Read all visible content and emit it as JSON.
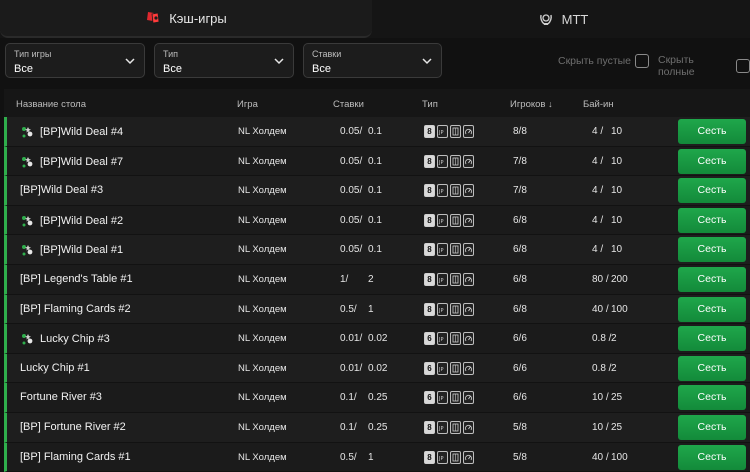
{
  "tabs": [
    {
      "label": "Кэш-игры",
      "icon": "poker-cards-icon",
      "active": true
    },
    {
      "label": "MTT",
      "icon": "trophy-wreath-icon",
      "active": false
    }
  ],
  "filters": {
    "game_type": {
      "label": "Тип игры",
      "value": "Все"
    },
    "type": {
      "label": "Тип",
      "value": "Все"
    },
    "stakes": {
      "label": "Ставки",
      "value": "Все"
    },
    "hide_empty": "Скрыть пустые",
    "hide_full": "Скрыть полные"
  },
  "table": {
    "headers": {
      "name": "Название стола",
      "game": "Игра",
      "stakes": "Ставки",
      "type": "Тип",
      "players": "Игроков",
      "buyin": "Бай-ин"
    },
    "sit_label": "Сесть",
    "rows": [
      {
        "name": "[BP]Wild Deal #4",
        "bp": true,
        "game": "NL Холдем",
        "stake_a": "0.05/",
        "stake_b": "0.1",
        "seats": "8",
        "players": "8/8",
        "buyin_a": "4 /",
        "buyin_b": "10"
      },
      {
        "name": "[BP]Wild Deal #7",
        "bp": true,
        "game": "NL Холдем",
        "stake_a": "0.05/",
        "stake_b": "0.1",
        "seats": "8",
        "players": "7/8",
        "buyin_a": "4 /",
        "buyin_b": "10"
      },
      {
        "name": "[BP]Wild Deal #3",
        "bp": false,
        "game": "NL Холдем",
        "stake_a": "0.05/",
        "stake_b": "0.1",
        "seats": "8",
        "players": "7/8",
        "buyin_a": "4 /",
        "buyin_b": "10"
      },
      {
        "name": "[BP]Wild Deal #2",
        "bp": true,
        "game": "NL Холдем",
        "stake_a": "0.05/",
        "stake_b": "0.1",
        "seats": "8",
        "players": "6/8",
        "buyin_a": "4 /",
        "buyin_b": "10"
      },
      {
        "name": "[BP]Wild Deal #1",
        "bp": true,
        "game": "NL Холдем",
        "stake_a": "0.05/",
        "stake_b": "0.1",
        "seats": "8",
        "players": "6/8",
        "buyin_a": "4 /",
        "buyin_b": "10"
      },
      {
        "name": "[BP] Legend's Table #1",
        "bp": false,
        "game": "NL Холдем",
        "stake_a": "1/",
        "stake_b": "2",
        "seats": "8",
        "players": "6/8",
        "buyin_a": "80 /",
        "buyin_b": "200"
      },
      {
        "name": "[BP] Flaming Cards #2",
        "bp": false,
        "game": "NL Холдем",
        "stake_a": "0.5/",
        "stake_b": "1",
        "seats": "8",
        "players": "6/8",
        "buyin_a": "40 /",
        "buyin_b": "100"
      },
      {
        "name": "Lucky Chip #3",
        "bp": true,
        "game": "NL Холдем",
        "stake_a": "0.01/",
        "stake_b": "0.02",
        "seats": "6",
        "players": "6/6",
        "buyin_a": "0.8 /",
        "buyin_b": "2"
      },
      {
        "name": "Lucky Chip #1",
        "bp": false,
        "game": "NL Холдем",
        "stake_a": "0.01/",
        "stake_b": "0.02",
        "seats": "6",
        "players": "6/6",
        "buyin_a": "0.8 /",
        "buyin_b": "2"
      },
      {
        "name": "Fortune River #3",
        "bp": false,
        "game": "NL Холдем",
        "stake_a": "0.1/",
        "stake_b": "0.25",
        "seats": "6",
        "players": "6/6",
        "buyin_a": "10 /",
        "buyin_b": "25"
      },
      {
        "name": "[BP] Fortune River #2",
        "bp": false,
        "game": "NL Холдем",
        "stake_a": "0.1/",
        "stake_b": "0.25",
        "seats": "8",
        "players": "5/8",
        "buyin_a": "10 /",
        "buyin_b": "25"
      },
      {
        "name": "[BP] Flaming Cards #1",
        "bp": false,
        "game": "NL Холдем",
        "stake_a": "0.5/",
        "stake_b": "1",
        "seats": "8",
        "players": "5/8",
        "buyin_a": "40 /",
        "buyin_b": "100"
      }
    ]
  },
  "colors": {
    "accent_green": "#1fa74b",
    "cash_icon_red": "#e0282e"
  }
}
